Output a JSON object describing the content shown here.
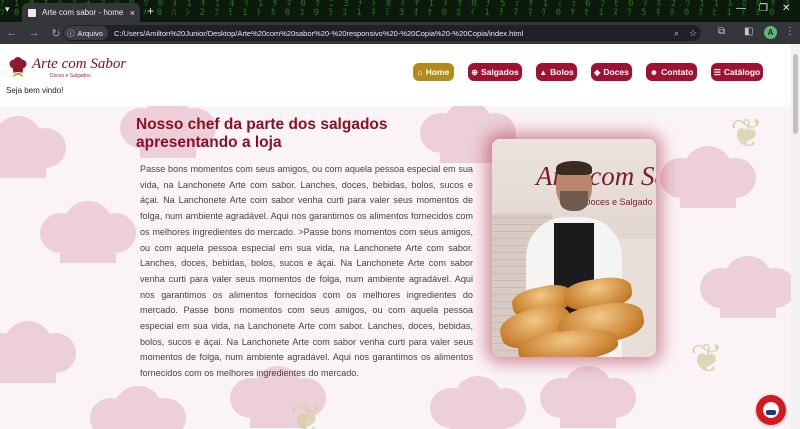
{
  "browser": {
    "tab_title": "Arte com sabor - home",
    "tab_close": "×",
    "new_tab": "+",
    "site_info_label": "Arquivo",
    "url": "C:/Users/Amilton%20Junior/Desktop/Arte%20com%20sabor%20-%20responsivo%20-%20Copia%20-%20Copia/index.html",
    "profile_initial": "A"
  },
  "site": {
    "logo_name": "Arte com Sabor",
    "logo_tagline": "Doces e Salgados",
    "welcome": "Seja bem vindo!",
    "nav": [
      {
        "label": "Home",
        "icon": "home-icon",
        "glyph": "⌂"
      },
      {
        "label": "Salgados",
        "icon": "plus-circle-icon",
        "glyph": "⊕"
      },
      {
        "label": "Bolos",
        "icon": "cake-icon",
        "glyph": "▲"
      },
      {
        "label": "Doces",
        "icon": "candy-icon",
        "glyph": "◆"
      },
      {
        "label": "Contato",
        "icon": "contact-icon",
        "glyph": "☻"
      },
      {
        "label": "Catálogo",
        "icon": "list-icon",
        "glyph": "☰"
      }
    ],
    "heading": "Nosso chef da parte dos salgados apresentando a loja",
    "paragraph": "Passe bons momentos com seus amigos, ou com aquela pessoa especial em sua vida, na Lanchonete Arte com sabor. Lanches, doces, bebidas, bolos, sucos e áçai. Na Lanchonete Arte com sabor venha curti para valer seus momentos de folga, num ambiente agradável. Aqui nos garantimos os alimentos fornecidos com os melhores ingredientes do mercado. >Passe bons momentos com seus amigos, ou com aquela pessoa especial em sua vida, na Lanchonete Arte com sabor. Lanches, doces, bebidas, bolos, sucos e áçai. Na Lanchonete Arte com sabor venha curti para valer seus momentos de folga, num ambiente agradável. Aqui nos garantimos os alimentos fornecidos com os melhores ingredientes do mercado. Passe bons momentos com seus amigos, ou com aquela pessoa especial em sua vida, na Lanchonete Arte com sabor. Lanches, doces, bebidas, bolos, sucos e áçai. Na Lanchonete Arte com sabor venha curti para valer seus momentos de folga, num ambiente agradável. Aqui nos garantimos os alimentos fornecidos com os melhores ingredientes do mercado.",
    "photo_sign": "Arte com Sab",
    "photo_sign_sub": "Doces e Salgado"
  },
  "colors": {
    "brand": "#a01234",
    "active_nav": "#b48a1c",
    "heading": "#8b0f25"
  }
}
